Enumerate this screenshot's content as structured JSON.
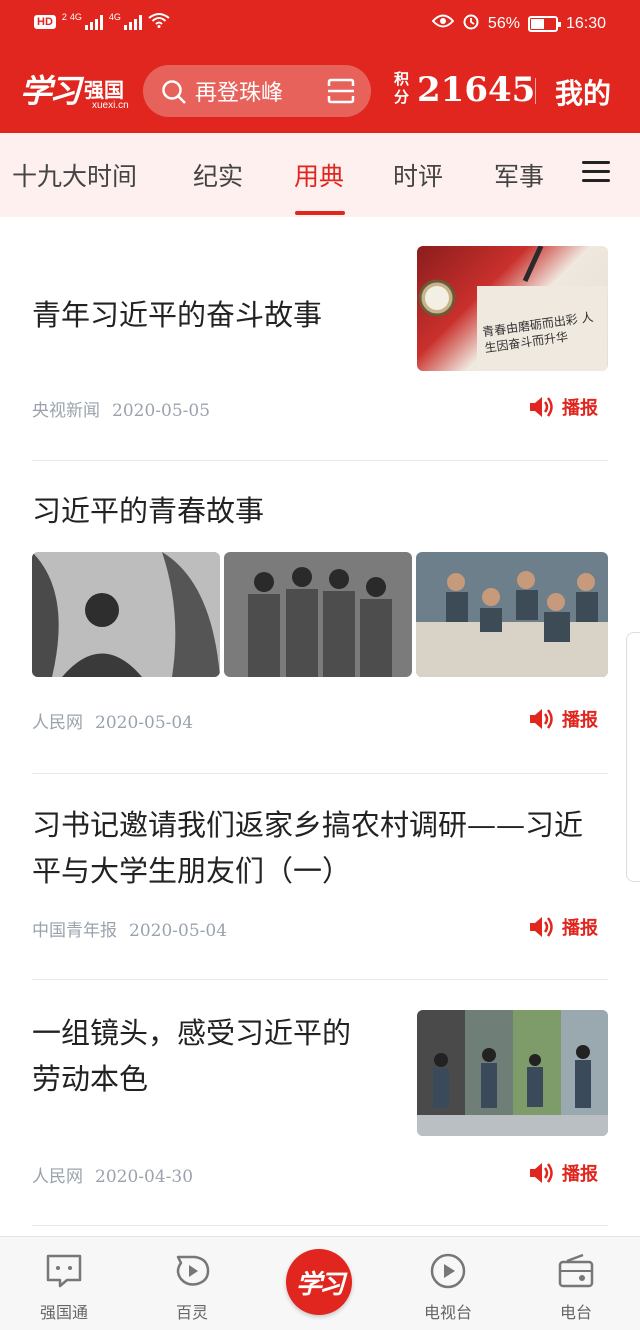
{
  "status_bar": {
    "hd": "HD",
    "sim1": "2",
    "net1": "4G",
    "net2": "4G",
    "battery_percent": "56%",
    "battery_level": 0.56,
    "time": "16:30"
  },
  "header": {
    "logo_script": "学习",
    "logo_text": "强国",
    "logo_domain": "xuexi.cn",
    "search_query": "再登珠峰",
    "points_label": "积分",
    "points_value": "21645",
    "mine_label": "我的"
  },
  "tabs": [
    {
      "label": "十九大时间"
    },
    {
      "label": "纪实"
    },
    {
      "label": "用典"
    },
    {
      "label": "时评"
    },
    {
      "label": "军事"
    }
  ],
  "active_tab": "用典",
  "articles": [
    {
      "title": "青年习近平的奋斗故事",
      "source": "央视新闻",
      "date": "2020-05-05",
      "broadcast": "播报",
      "thumb_caption": "青春由磨砺而出彩 人生因奋斗而升华"
    },
    {
      "title": "习近平的青春故事",
      "source": "人民网",
      "date": "2020-05-04",
      "broadcast": "播报"
    },
    {
      "title_line1": "习书记邀请我们返家乡搞农村调研——习近",
      "title_line2": "平与大学生朋友们（一）",
      "source": "中国青年报",
      "date": "2020-05-04",
      "broadcast": "播报"
    },
    {
      "title_line1": "一组镜头，感受习近平的",
      "title_line2": "劳动本色",
      "source": "人民网",
      "date": "2020-04-30",
      "broadcast": "播报"
    }
  ],
  "bottom_nav": {
    "items": [
      {
        "label": "强国通",
        "icon": "chat-icon"
      },
      {
        "label": "百灵",
        "icon": "play-bubble-icon"
      },
      {
        "label": "学习",
        "icon": "xuexi-logo"
      },
      {
        "label": "电视台",
        "icon": "play-circle-icon"
      },
      {
        "label": "电台",
        "icon": "radio-icon"
      }
    ]
  },
  "colors": {
    "brand_red": "#e0261e",
    "tab_bg": "#fdf0ee",
    "meta_gray": "#9aa3ad"
  }
}
